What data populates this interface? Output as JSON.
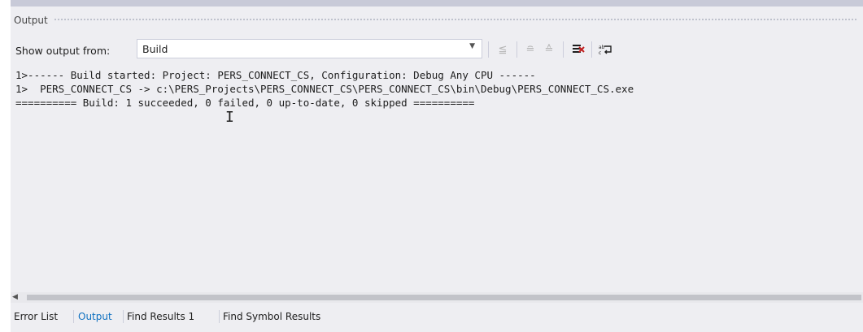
{
  "panel": {
    "title": "Output"
  },
  "toolbar": {
    "show_output_label": "Show output from:",
    "source_value": "Build",
    "icons": [
      "go-to-previous-message-icon",
      "find-previous-icon",
      "find-next-icon",
      "clear-all-icon",
      "toggle-word-wrap-icon"
    ]
  },
  "output": {
    "lines": [
      "1>------ Build started: Project: PERS_CONNECT_CS, Configuration: Debug Any CPU ------",
      "1>  PERS_CONNECT_CS -> c:\\PERS_Projects\\PERS_CONNECT_CS\\PERS_CONNECT_CS\\bin\\Debug\\PERS_CONNECT_CS.exe",
      "========== Build: 1 succeeded, 0 failed, 0 up-to-date, 0 skipped =========="
    ]
  },
  "tabs": [
    {
      "label": "Error List",
      "selected": false
    },
    {
      "label": "Output",
      "selected": true
    },
    {
      "label": "Find Results 1",
      "selected": false
    },
    {
      "label": "Find Symbol Results",
      "selected": false
    }
  ],
  "colors": {
    "background": "#eeeef2",
    "selected_tab": "#0e70c0",
    "clear_icon": "#c12020",
    "text": "#1e1e1e"
  }
}
